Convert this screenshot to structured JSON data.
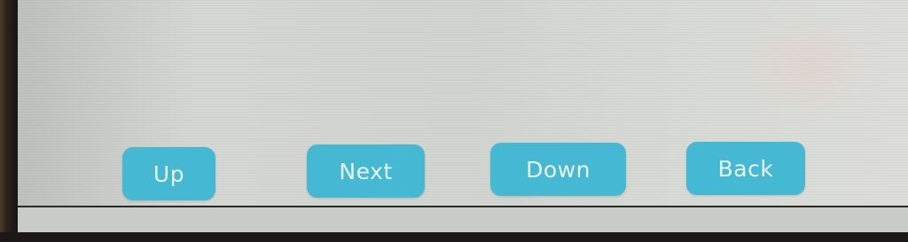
{
  "nav": {
    "up_label": "Up",
    "next_label": "Next",
    "down_label": "Down",
    "back_label": "Back"
  },
  "colors": {
    "button_bg": "#45b8d4",
    "button_text": "#e9f4f7",
    "screen_bg": "#d5d7d3"
  }
}
